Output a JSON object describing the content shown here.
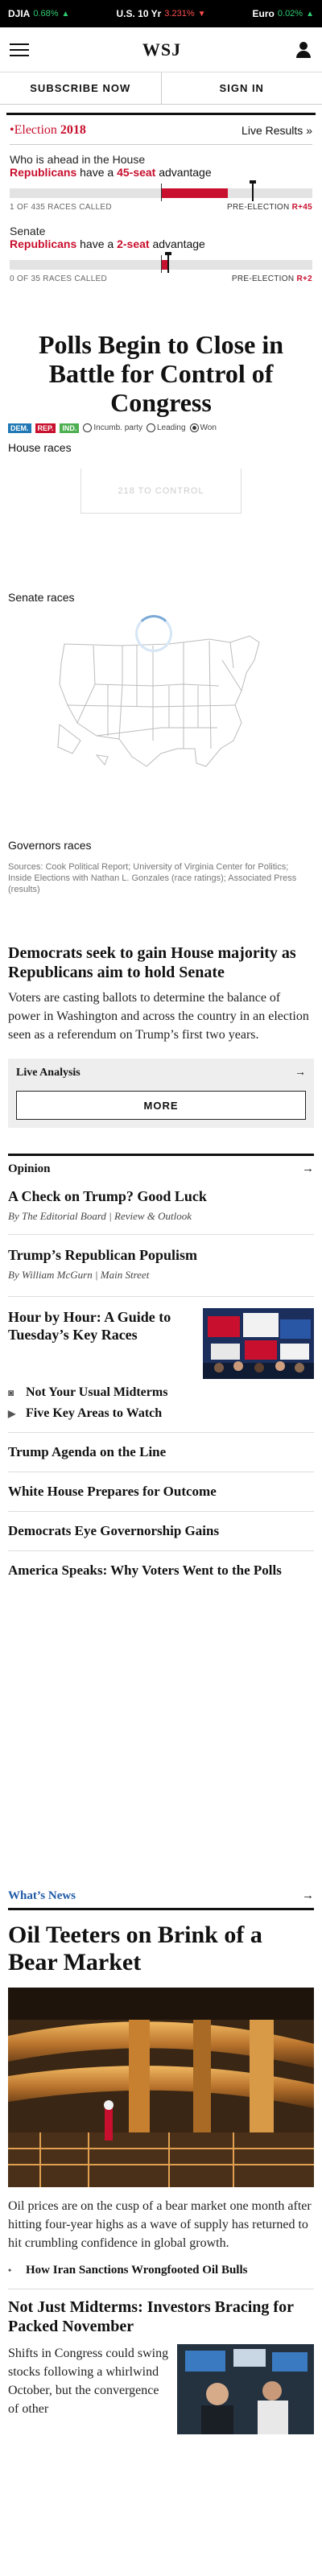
{
  "ticker": [
    {
      "name": "DJIA",
      "value": "0.68%",
      "dir": "up"
    },
    {
      "name": "U.S. 10 Yr",
      "value": "3.231%",
      "dir": "down"
    },
    {
      "name": "Euro",
      "value": "0.02%",
      "dir": "up"
    }
  ],
  "header": {
    "logo": "WSJ",
    "subscribe": "SUBSCRIBE NOW",
    "signin": "SIGN IN"
  },
  "election": {
    "logo_prefix": "Election",
    "logo_year": "2018",
    "live_results": "Live Results",
    "house": {
      "question": "Who is ahead in the House",
      "party": "Republicans",
      "mid": "have a",
      "margin": "45-seat",
      "suffix": "advantage",
      "called": "1 OF 435 RACES CALLED",
      "pre_label": "PRE-ELECTION",
      "pre_value": "R+45",
      "share": 0.72,
      "marker": 0.8
    },
    "senate": {
      "question": "Senate",
      "party": "Republicans",
      "mid": "have a",
      "margin": "2-seat",
      "suffix": "advantage",
      "called": "0 OF 35 RACES CALLED",
      "pre_label": "PRE-ELECTION",
      "pre_value": "R+2",
      "share": 0.52,
      "marker": 0.52
    }
  },
  "main": {
    "headline": "Polls Begin to Close in Battle for Control of Congress",
    "legend": {
      "dem": "DEM.",
      "rep": "REP.",
      "ind": "IND.",
      "incumb": "Incumb. party",
      "leading": "Leading",
      "won": "Won"
    },
    "house_label": "House races",
    "control_text": "218 TO CONTROL",
    "senate_label": "Senate races",
    "governors_label": "Governors races",
    "sources": "Sources: Cook Political Report; University of Virginia Center for Politics; Inside Elections with Nathan L. Gonzales (race ratings); Associated Press (results)"
  },
  "story": {
    "headline": "Democrats seek to gain House majority as Republicans aim to hold Senate",
    "body": "Voters are casting ballots to determine the balance of power in Washington and across the country in an election seen as a referendum on Trump’s first two years."
  },
  "live": {
    "title": "Live Analysis",
    "more": "MORE"
  },
  "opinion": {
    "title": "Opinion",
    "items": [
      {
        "title": "A Check on Trump? Good Luck",
        "byline": "By The Editorial Board | Review & Outlook"
      },
      {
        "title": "Trump’s Republican Populism",
        "byline": "By William McGurn | Main Street"
      }
    ]
  },
  "hour": {
    "title": "Hour by Hour: A Guide to Tuesday’s Key Races",
    "bullets": [
      {
        "icon": "camera-icon",
        "text": "Not Your Usual Midterms"
      },
      {
        "icon": "play-icon",
        "text": "Five Key Areas to Watch"
      }
    ]
  },
  "list": [
    "Trump Agenda on the Line",
    "White House Prepares for Outcome",
    "Democrats Eye Governorship Gains",
    "America Speaks: Why Voters Went to the Polls"
  ],
  "whats_news": {
    "label": "What’s News",
    "oil_headline": "Oil Teeters on Brink of a Bear Market",
    "oil_body": "Oil prices are on the cusp of a bear market one month after hitting four-year highs as a wave of supply has returned to hit crumbling confidence in global growth.",
    "oil_bullet": "How Iran Sanctions Wrongfooted Oil Bulls",
    "second_headline": "Not Just Midterms: Investors Bracing for Packed November",
    "second_body": "Shifts in Congress could swing stocks following a whirlwind October, but the convergence of other"
  },
  "colors": {
    "rep": "#c8102e",
    "dem": "#1f78b4",
    "ind": "#4caf50",
    "link": "#1f5aa6"
  }
}
